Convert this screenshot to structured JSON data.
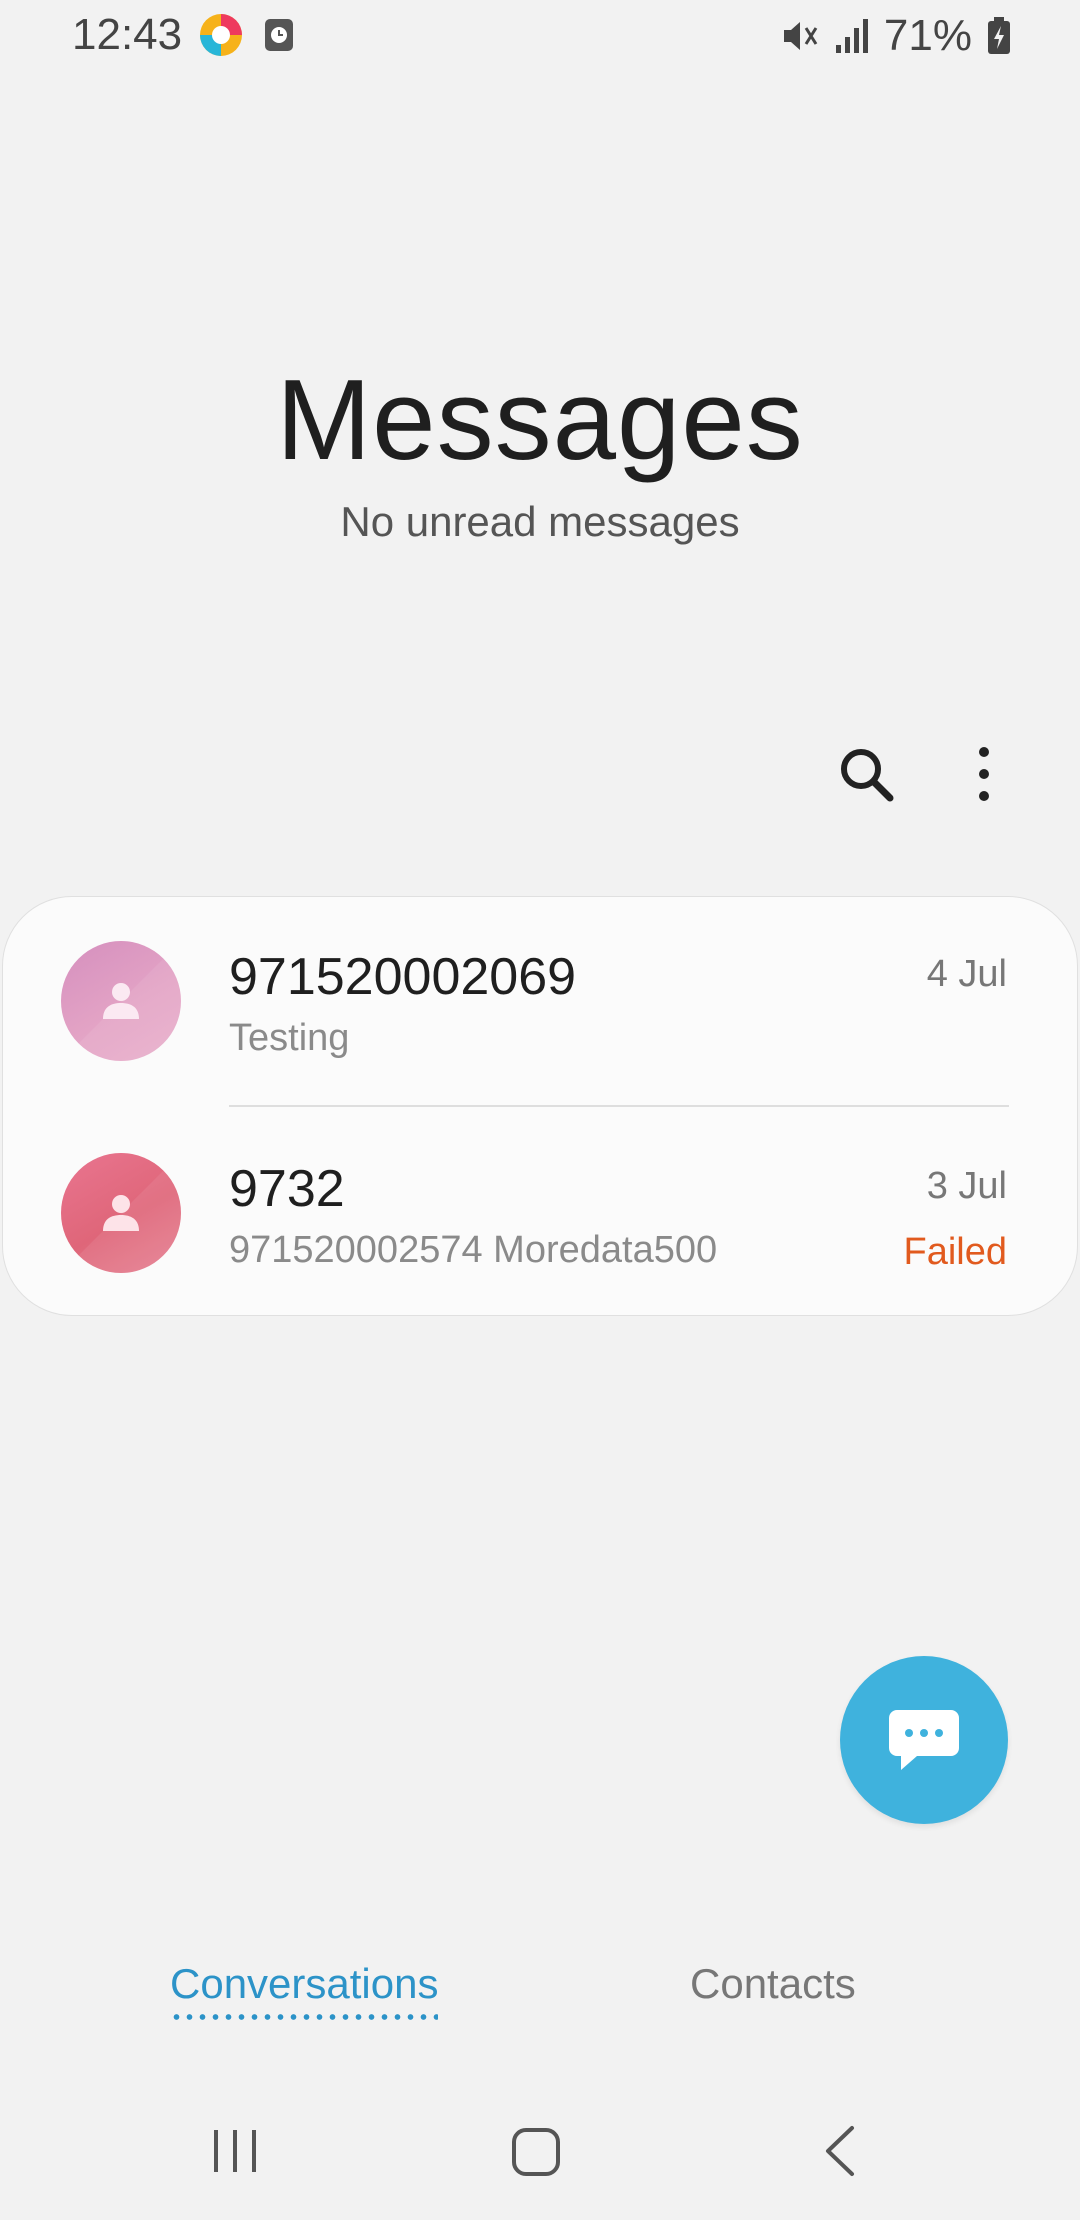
{
  "status_bar": {
    "time": "12:43",
    "battery_percent": "71%",
    "icons": [
      "colorful-app-icon",
      "clock-app-icon",
      "mute-icon",
      "signal-icon",
      "battery-charging-icon"
    ]
  },
  "header": {
    "title": "Messages",
    "subtitle": "No unread messages"
  },
  "actions": {
    "search_icon": "search-icon",
    "more_icon": "more-vertical-icon"
  },
  "conversations": [
    {
      "name": "971520002069",
      "snippet": "Testing",
      "date": "4 Jul",
      "status": "",
      "avatar_color": "#e3a3c5"
    },
    {
      "name": "9732",
      "snippet": "971520002574 Moredata500",
      "date": "3 Jul",
      "status": "Failed",
      "avatar_color": "#df6679"
    }
  ],
  "fab": {
    "icon": "compose-message-icon",
    "color": "#3fb2dd"
  },
  "tabs": [
    {
      "label": "Conversations",
      "active": true
    },
    {
      "label": "Contacts",
      "active": false
    }
  ],
  "colors": {
    "accent": "#2c93c8",
    "failed": "#e15a1e",
    "background": "#f2f2f2"
  },
  "navigation": {
    "icons": [
      "recents-icon",
      "home-icon",
      "back-icon"
    ]
  }
}
